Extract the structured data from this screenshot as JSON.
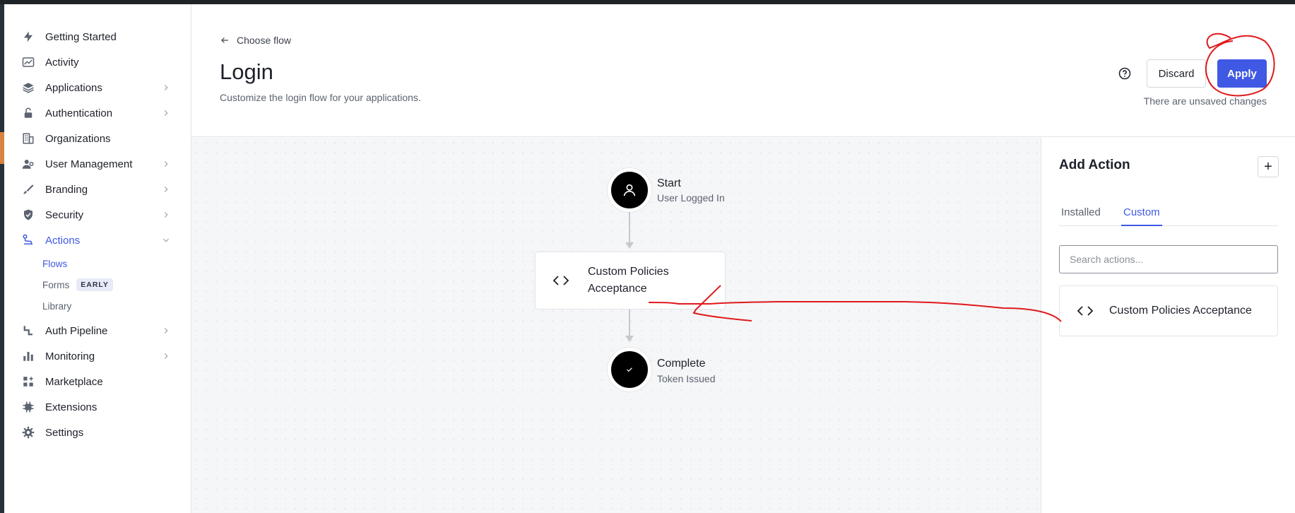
{
  "sidebar": {
    "items": [
      {
        "label": "Getting Started",
        "icon": "lightning-icon"
      },
      {
        "label": "Activity",
        "icon": "chart-line-icon"
      },
      {
        "label": "Applications",
        "icon": "layers-icon"
      },
      {
        "label": "Authentication",
        "icon": "lock-icon"
      },
      {
        "label": "Organizations",
        "icon": "building-icon"
      },
      {
        "label": "User Management",
        "icon": "users-icon"
      },
      {
        "label": "Branding",
        "icon": "brush-icon"
      },
      {
        "label": "Security",
        "icon": "shield-icon"
      },
      {
        "label": "Actions",
        "icon": "actions-icon"
      },
      {
        "label": "Auth Pipeline",
        "icon": "pipeline-icon"
      },
      {
        "label": "Monitoring",
        "icon": "bar-chart-icon"
      },
      {
        "label": "Marketplace",
        "icon": "marketplace-icon"
      },
      {
        "label": "Extensions",
        "icon": "chip-icon"
      },
      {
        "label": "Settings",
        "icon": "gear-icon"
      }
    ],
    "actions_sub": [
      {
        "label": "Flows"
      },
      {
        "label": "Forms",
        "badge": "EARLY"
      },
      {
        "label": "Library"
      }
    ]
  },
  "header": {
    "back_label": "Choose flow",
    "title": "Login",
    "subtitle": "Customize the login flow for your applications.",
    "discard_label": "Discard",
    "apply_label": "Apply",
    "unsaved_text": "There are unsaved changes"
  },
  "flow": {
    "start": {
      "title": "Start",
      "subtitle": "User Logged In"
    },
    "action": {
      "name": "Custom Policies Acceptance"
    },
    "end": {
      "title": "Complete",
      "subtitle": "Token Issued"
    }
  },
  "panel": {
    "title": "Add Action",
    "plus_label": "+",
    "tabs": [
      {
        "label": "Installed"
      },
      {
        "label": "Custom"
      }
    ],
    "active_tab": "Custom",
    "search_placeholder": "Search actions...",
    "items": [
      {
        "name": "Custom Policies Acceptance"
      }
    ]
  },
  "colors": {
    "accent": "#3f59e4",
    "annotation": "#e0191b",
    "node": "#000000"
  }
}
